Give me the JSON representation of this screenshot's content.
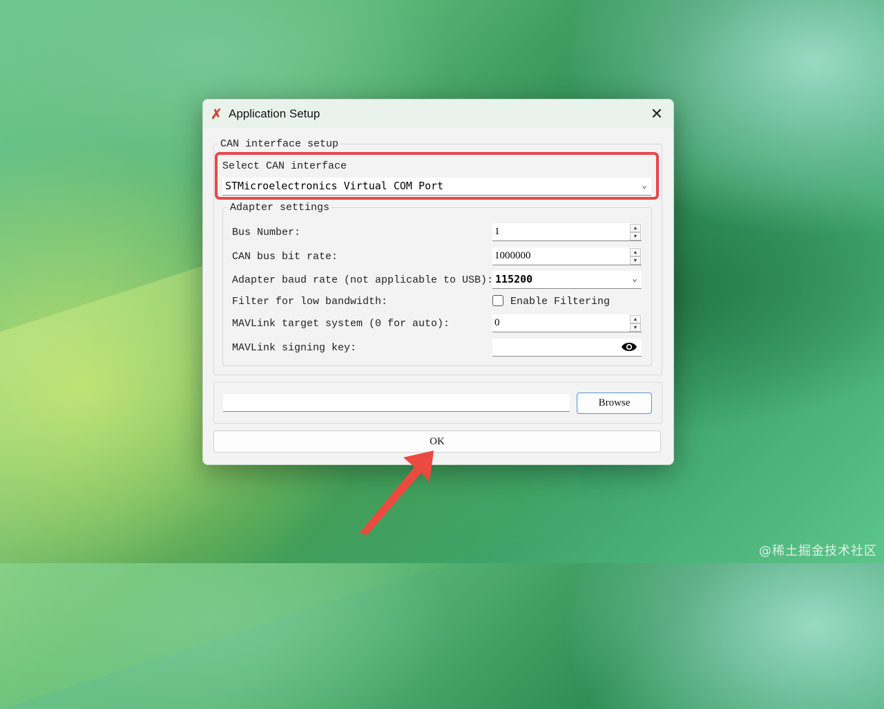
{
  "dialog": {
    "title": "Application Setup",
    "close_label": "✕"
  },
  "can_setup": {
    "group_title": "CAN interface setup",
    "select_label": "Select CAN interface",
    "selected_interface": "STMicroelectronics Virtual COM Port"
  },
  "adapter": {
    "group_title": "Adapter settings",
    "bus_number_label": "Bus Number:",
    "bus_number_value": "1",
    "bit_rate_label": "CAN bus bit rate:",
    "bit_rate_value": "1000000",
    "baud_label": "Adapter baud rate (not applicable to USB):",
    "baud_value": "115200",
    "filter_label": "Filter for low bandwidth:",
    "filter_checkbox_label": "Enable Filtering",
    "filter_checked": false,
    "target_system_label": "MAVLink target system (0 for auto):",
    "target_system_value": "0",
    "signing_key_label": "MAVLink signing key:",
    "signing_key_value": ""
  },
  "file": {
    "path_value": "",
    "browse_label": "Browse"
  },
  "ok_label": "OK",
  "watermark": "@稀土掘金技术社区",
  "colors": {
    "highlight": "#e8474a",
    "arrow": "#ea4a3f"
  }
}
